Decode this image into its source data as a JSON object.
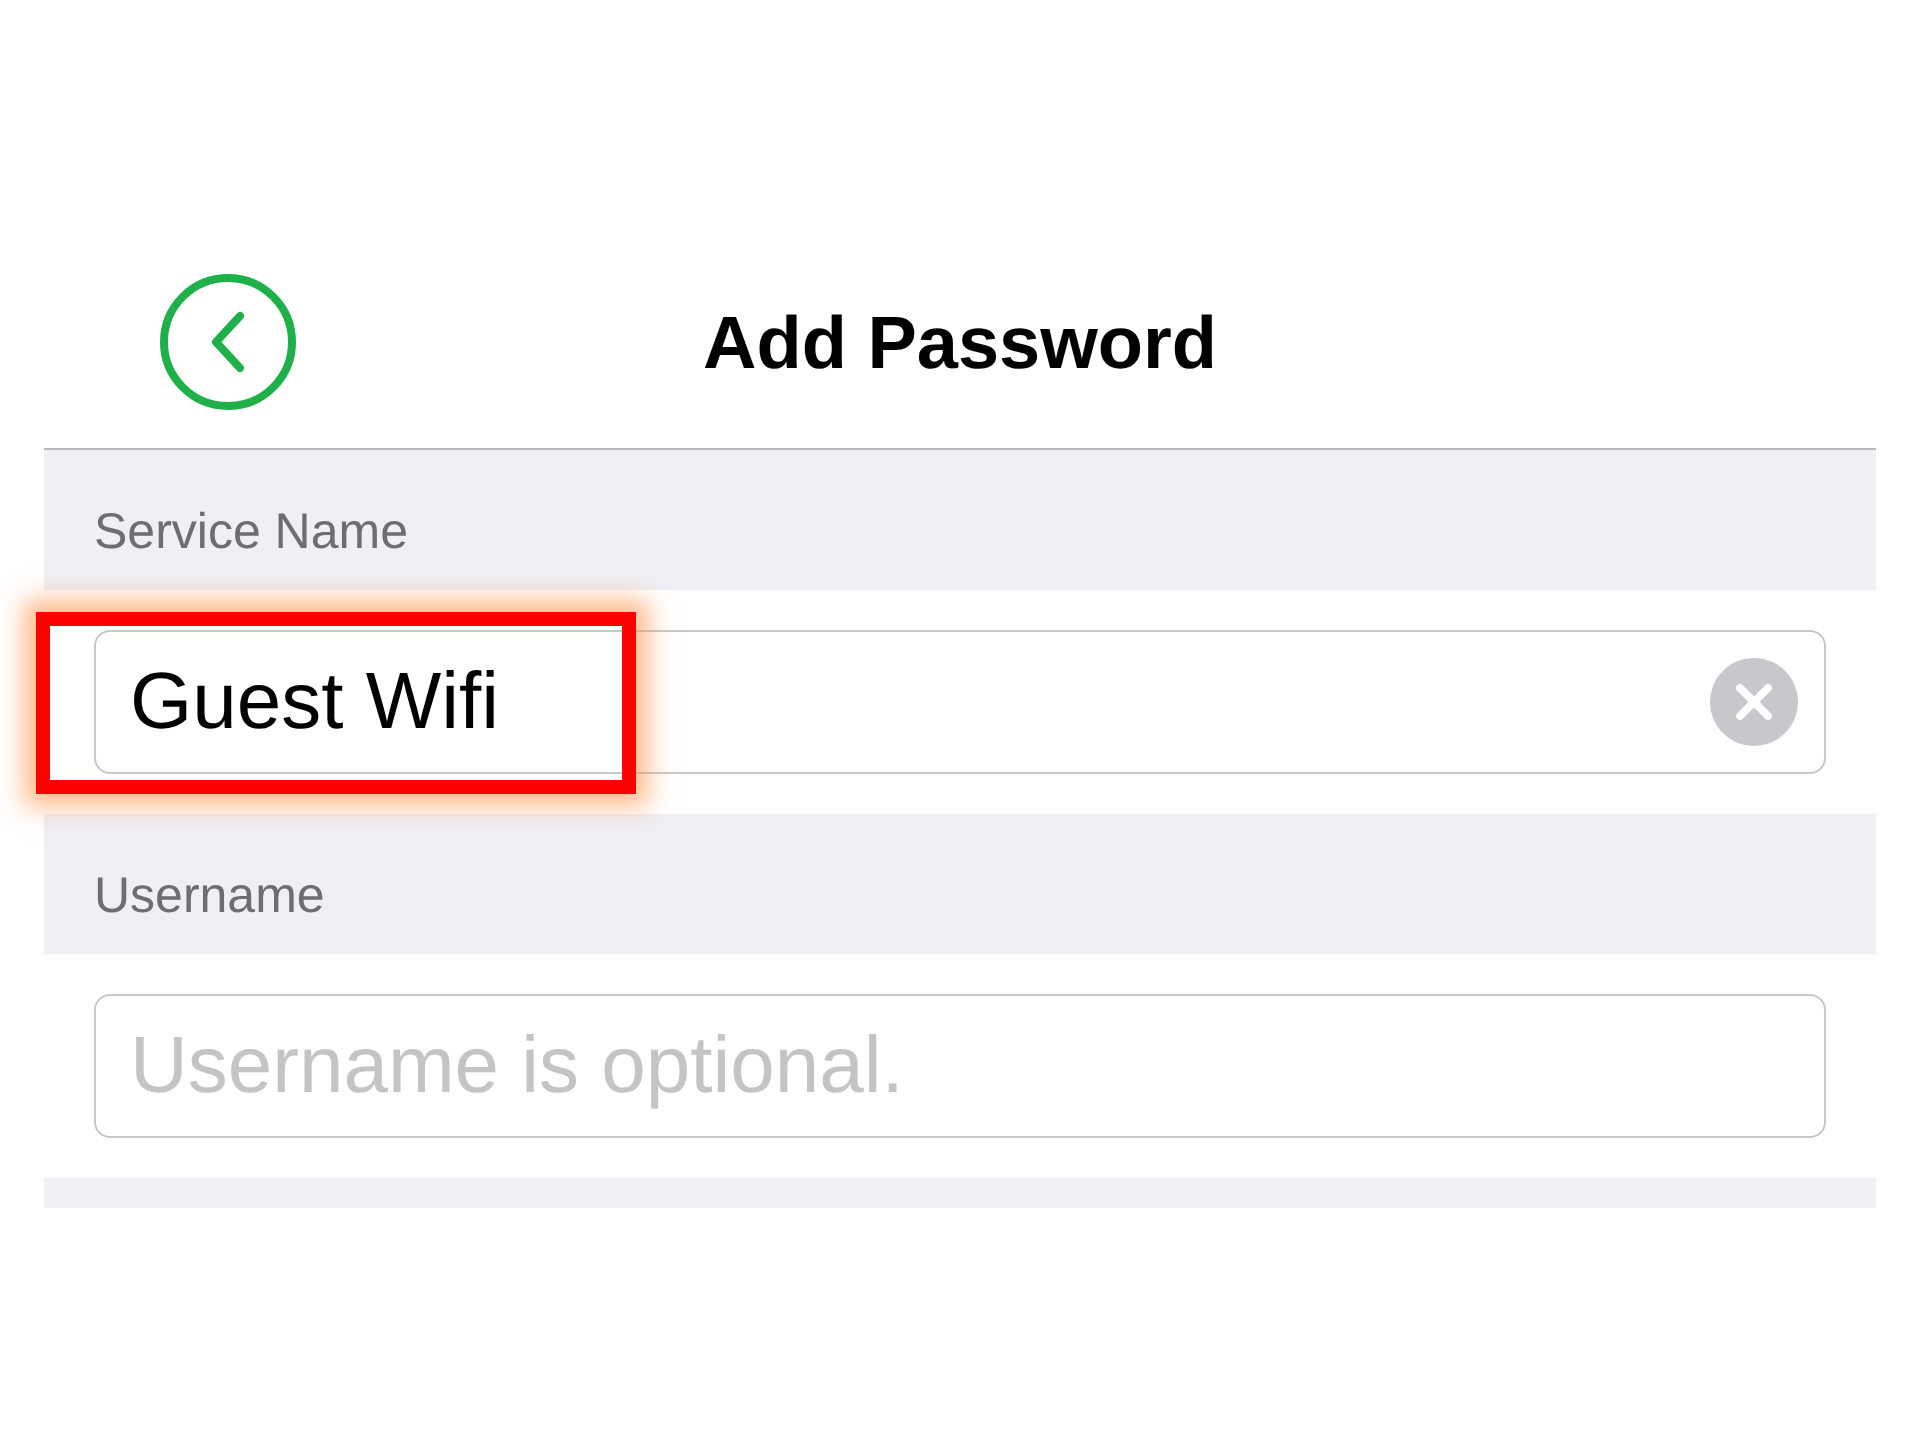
{
  "header": {
    "title": "Add Password"
  },
  "fields": [
    {
      "label": "Service Name",
      "value": "Guest Wifi",
      "highlighted": true
    },
    {
      "label": "Username",
      "placeholder": "Username is optional.",
      "highlighted": false
    }
  ]
}
